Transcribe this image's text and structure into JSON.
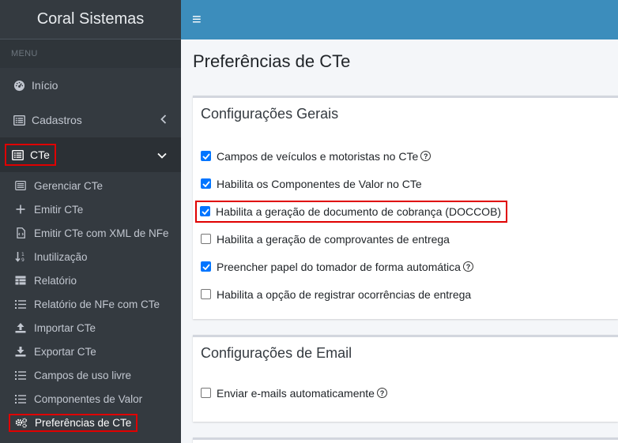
{
  "brand": "Coral Sistemas",
  "menu_header": "MENU",
  "nav": {
    "inicio": "Início",
    "cadastros": "Cadastros",
    "cte": "CTe"
  },
  "subnav": [
    {
      "label": "Gerenciar CTe",
      "icon": "list-icon"
    },
    {
      "label": "Emitir CTe",
      "icon": "plus-icon"
    },
    {
      "label": "Emitir CTe com XML de NFe",
      "icon": "file-code-icon"
    },
    {
      "label": "Inutilização",
      "icon": "sort-icon"
    },
    {
      "label": "Relatório",
      "icon": "table-icon"
    },
    {
      "label": "Relatório de NFe com CTe",
      "icon": "list-ol-icon"
    },
    {
      "label": "Importar CTe",
      "icon": "upload-icon"
    },
    {
      "label": "Exportar CTe",
      "icon": "download-icon"
    },
    {
      "label": "Campos de uso livre",
      "icon": "list-icon"
    },
    {
      "label": "Componentes de Valor",
      "icon": "list-icon"
    },
    {
      "label": "Preferências de CTe",
      "icon": "cogs-icon"
    }
  ],
  "topbar": {
    "menu_toggle": "≡"
  },
  "page_title": "Preferências de CTe",
  "general": {
    "title": "Configurações Gerais",
    "options": [
      {
        "label": "Campos de veículos e motoristas no CTe",
        "checked": true,
        "help": true
      },
      {
        "label": "Habilita os Componentes de Valor no CTe",
        "checked": true,
        "help": false
      },
      {
        "label": "Habilita a geração de documento de cobrança (DOCCOB)",
        "checked": true,
        "help": false
      },
      {
        "label": "Habilita a geração de comprovantes de entrega",
        "checked": false,
        "help": false
      },
      {
        "label": "Preencher papel do tomador de forma automática",
        "checked": true,
        "help": true
      },
      {
        "label": "Habilita a opção de registrar ocorrências de entrega",
        "checked": false,
        "help": false
      }
    ]
  },
  "email": {
    "title": "Configurações de Email",
    "options": [
      {
        "label": "Enviar e-mails automaticamente",
        "checked": false,
        "help": true
      }
    ]
  },
  "colors": {
    "sidebar": "#343a40",
    "topbar": "#3c8dbc",
    "highlight": "#e00000",
    "checkbox": "#0075ff"
  }
}
